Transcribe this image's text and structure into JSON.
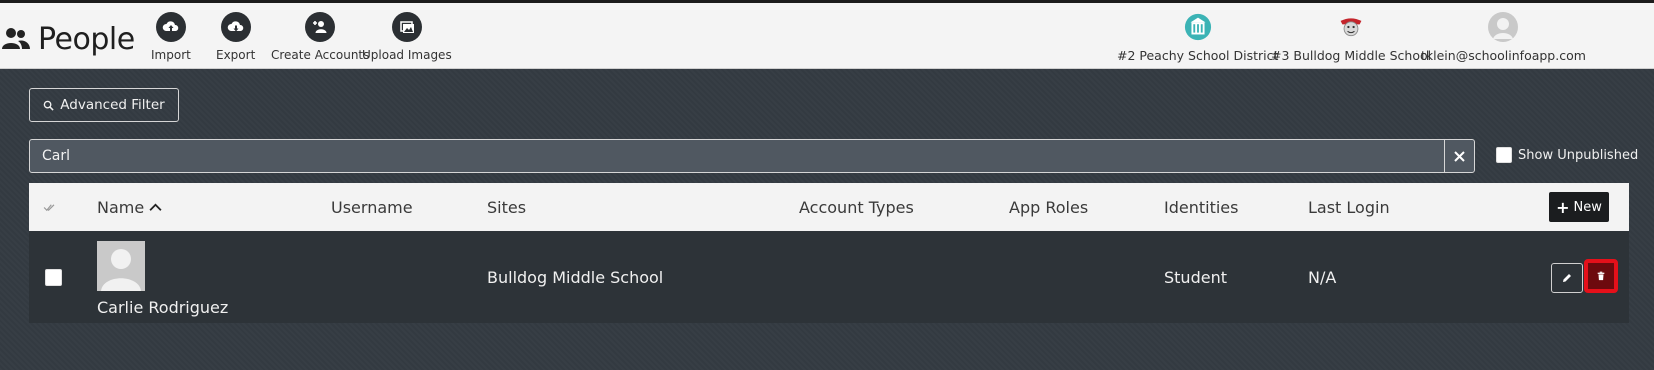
{
  "header": {
    "title": "People",
    "tools": [
      {
        "label": "Import",
        "icon": "cloud-upload-icon"
      },
      {
        "label": "Export",
        "icon": "cloud-download-icon"
      },
      {
        "label": "Create Accounts",
        "icon": "add-user-icon"
      },
      {
        "label": "Upload Images",
        "icon": "images-icon"
      }
    ],
    "context": {
      "district": "#2 Peachy School District",
      "school": "#3 Bulldog Middle School",
      "user": "tklein@schoolinfoapp.com"
    }
  },
  "filter": {
    "advanced_label": "Advanced Filter",
    "search_value": "Carl",
    "show_unpublished_label": "Show Unpublished"
  },
  "table": {
    "columns": [
      "Name",
      "Username",
      "Sites",
      "Account Types",
      "App Roles",
      "Identities",
      "Last Login"
    ],
    "new_label": "New",
    "rows": [
      {
        "name": "Carlie Rodriguez",
        "username": "",
        "sites": "Bulldog Middle School",
        "account_types": "",
        "app_roles": "",
        "identities": "Student",
        "last_login": "N/A"
      }
    ]
  },
  "colors": {
    "background": "#343b42",
    "header_bg": "#f4f4f4",
    "delete_highlight": "#e5101a"
  }
}
